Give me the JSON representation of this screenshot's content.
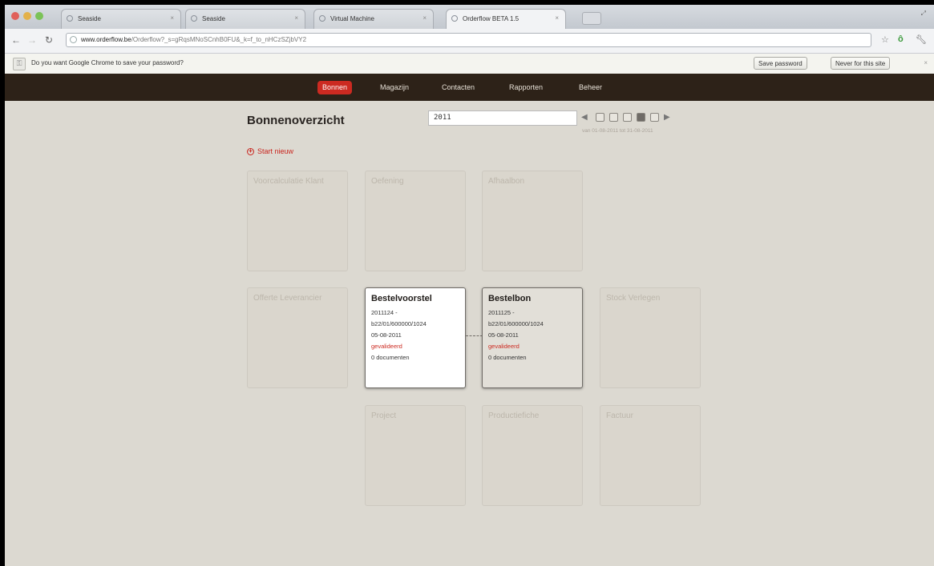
{
  "browser": {
    "tabs": [
      {
        "label": "Seaside"
      },
      {
        "label": "Seaside"
      },
      {
        "label": "Virtual Machine"
      },
      {
        "label": "Orderflow BETA 1.5"
      }
    ],
    "url_host": "www.orderflow.be",
    "url_path": "/Orderflow?_s=gRqsMNoSCnhB0FU&_k=f_to_nHCzSZjbVY2",
    "infobar": {
      "message": "Do you want Google Chrome to save your password?",
      "save_label": "Save password",
      "never_label": "Never for this site",
      "close": "×"
    }
  },
  "nav": {
    "items": [
      "Bonnen",
      "Magazijn",
      "Contacten",
      "Rapporten",
      "Beheer"
    ],
    "active": "Bonnen"
  },
  "page": {
    "title": "Bonnenoverzicht",
    "year": "2011",
    "date_range": "van 01-08-2011 tot 31-08-2011",
    "start_new": "Start nieuw"
  },
  "cards": {
    "voorcalculatie": {
      "name": "Voorcalculatie Klant"
    },
    "oefening": {
      "name": "Oefening"
    },
    "afhaalbon": {
      "name": "Afhaalbon"
    },
    "offerte": {
      "name": "Offerte Leverancier"
    },
    "bestelvoorstel": {
      "name": "Bestelvoorstel",
      "number": "2011124 -",
      "ref": "b22/01/600000/1024",
      "date": "05-08-2011",
      "status": "gevalideerd",
      "docs": "0 documenten"
    },
    "bestelbon": {
      "name": "Bestelbon",
      "number": "2011125 -",
      "ref": "b22/01/600000/1024",
      "date": "05-08-2011",
      "status": "gevalideerd",
      "docs": "0 documenten"
    },
    "stock": {
      "name": "Stock Verlegen"
    },
    "project": {
      "name": "Project"
    },
    "productiefiche": {
      "name": "Productiefiche"
    },
    "factuur": {
      "name": "Factuur"
    }
  },
  "colors": {
    "accent": "#cc2a21",
    "nav_bg": "#2d2218",
    "page_bg": "#dcd9d1"
  }
}
